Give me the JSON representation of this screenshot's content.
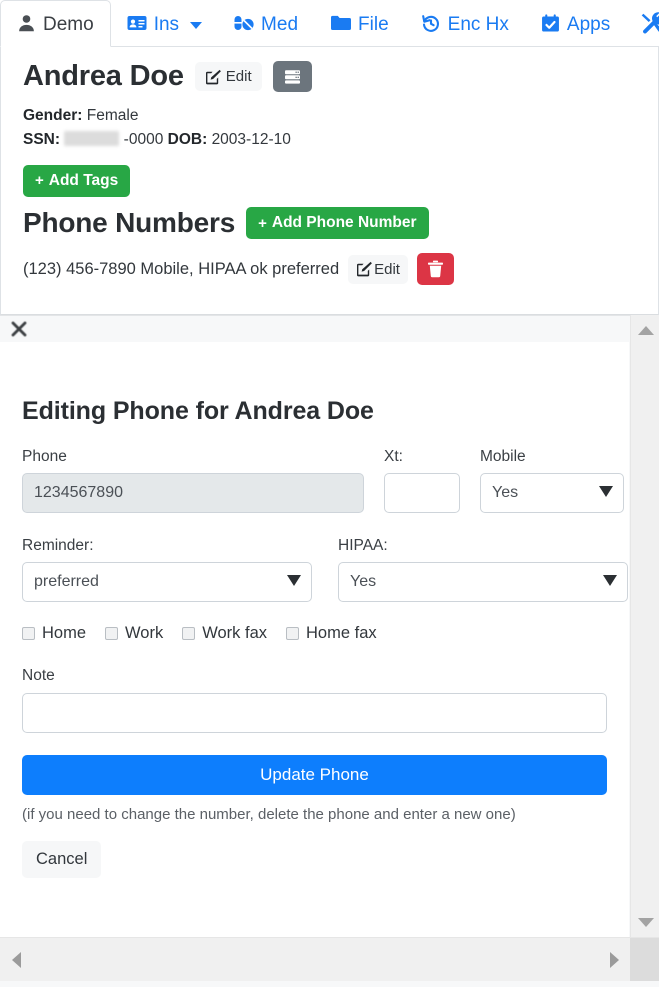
{
  "tabs": [
    {
      "label": "Demo",
      "icon": "user-icon",
      "active": true,
      "caret": false
    },
    {
      "label": "Ins",
      "icon": "id-card-icon",
      "active": false,
      "caret": true
    },
    {
      "label": "Med",
      "icon": "pills-icon",
      "active": false,
      "caret": false
    },
    {
      "label": "File",
      "icon": "folder-icon",
      "active": false,
      "caret": false
    },
    {
      "label": "Enc Hx",
      "icon": "clock-history-icon",
      "active": false,
      "caret": false
    },
    {
      "label": "Apps",
      "icon": "calendar-check-icon",
      "active": false,
      "caret": false
    },
    {
      "label": "",
      "icon": "tools-icon",
      "active": false,
      "caret": false
    }
  ],
  "patient": {
    "name": "Andrea Doe",
    "edit_label": "Edit",
    "gender_label": "Gender:",
    "gender_value": "Female",
    "ssn_label": "SSN:",
    "ssn_value": "-0000",
    "ssn_redacted": true,
    "dob_label": "DOB:",
    "dob_value": "2003-12-10",
    "add_tags_label": "Add Tags"
  },
  "phones": {
    "section_title": "Phone Numbers",
    "add_label": "Add Phone Number",
    "rows": [
      {
        "text": "(123) 456-7890 Mobile, HIPAA ok preferred",
        "edit_label": "Edit",
        "delete_icon": "trash-icon"
      }
    ]
  },
  "modal": {
    "close_icon": "close-icon",
    "title": "Editing Phone for Andrea Doe",
    "phone_label": "Phone",
    "phone_value": "1234567890",
    "phone_disabled": true,
    "xt_label": "Xt:",
    "xt_value": "",
    "xt_placeholder": "",
    "mobile_label": "Mobile",
    "mobile_value": "Yes",
    "reminder_label": "Reminder:",
    "reminder_value": "preferred",
    "hipaa_label": "HIPAA:",
    "hipaa_value": "Yes",
    "checkboxes": [
      {
        "label": "Home",
        "checked": false
      },
      {
        "label": "Work",
        "checked": false
      },
      {
        "label": "Work fax",
        "checked": false
      },
      {
        "label": "Home fax",
        "checked": false
      }
    ],
    "note_label": "Note",
    "note_value": "",
    "note_placeholder": "",
    "submit_label": "Update Phone",
    "hint": "(if you need to change the number, delete the phone and enter a new one)",
    "cancel_label": "Cancel"
  },
  "colors": {
    "link_blue": "#1a7bf2",
    "primary_blue": "#0d7efd",
    "success_green": "#28a745",
    "danger_red": "#dc3545",
    "dark_gray": "#6c757d"
  }
}
